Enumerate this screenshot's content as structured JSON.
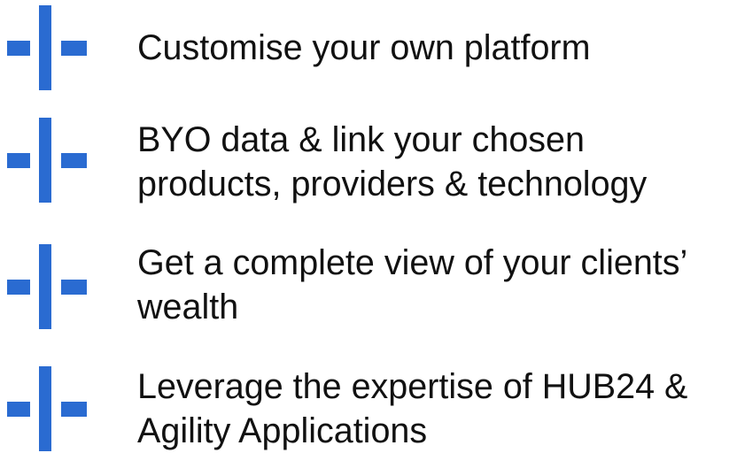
{
  "colors": {
    "icon_blue": "#2a6bd1",
    "text": "#111111",
    "background": "#ffffff"
  },
  "items": [
    {
      "icon": "plus-cross-icon",
      "lines": [
        "Customise your own platform"
      ]
    },
    {
      "icon": "plus-cross-icon",
      "lines": [
        "BYO data & link your chosen",
        "products, providers & technology"
      ]
    },
    {
      "icon": "plus-cross-icon",
      "lines": [
        "Get a complete view of your clients’",
        "wealth"
      ]
    },
    {
      "icon": "plus-cross-icon",
      "lines": [
        "Leverage the expertise of HUB24 &",
        "Agility Applications"
      ]
    }
  ]
}
